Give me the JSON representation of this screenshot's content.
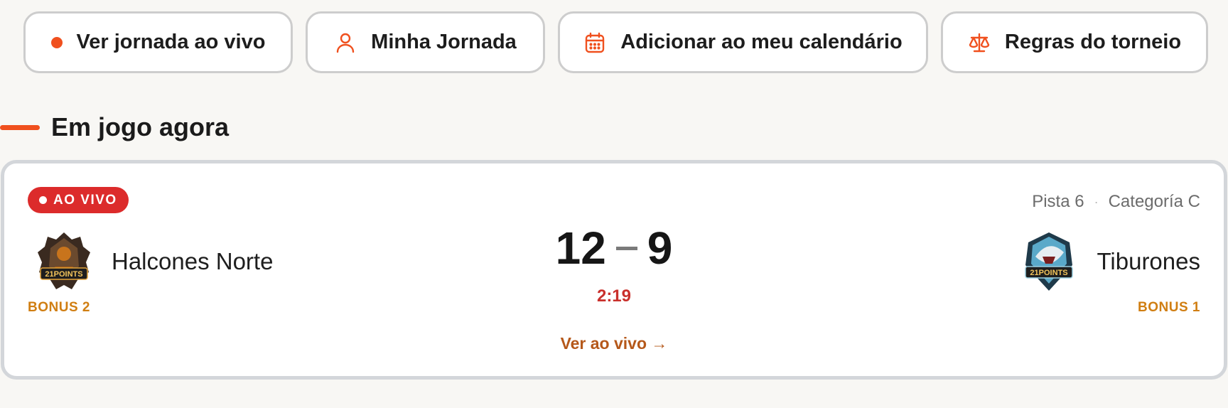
{
  "actions": {
    "live": {
      "label": "Ver jornada ao vivo",
      "icon": "live-dot-icon"
    },
    "mine": {
      "label": "Minha Jornada",
      "icon": "user-icon"
    },
    "calendar": {
      "label": "Adicionar ao meu calendário",
      "icon": "calendar-icon"
    },
    "rules": {
      "label": "Regras do torneio",
      "icon": "scale-icon"
    }
  },
  "section": {
    "title": "Em jogo agora"
  },
  "match": {
    "status": "AO VIVO",
    "court": "Pista 6",
    "separator": "·",
    "category": "Categoría C",
    "home": {
      "name": "Halcones Norte",
      "bonus": "BONUS 2",
      "score": "12",
      "logo_text": "21POINTS"
    },
    "away": {
      "name": "Tiburones",
      "bonus": "BONUS 1",
      "score": "9",
      "logo_text": "21POINTS"
    },
    "clock": "2:19",
    "watch_label": "Ver ao vivo →"
  },
  "colors": {
    "accent": "#f0501e",
    "live_red": "#dc2b2b",
    "bonus": "#d07e12",
    "link": "#b5581a",
    "background": "#f8f7f4"
  }
}
